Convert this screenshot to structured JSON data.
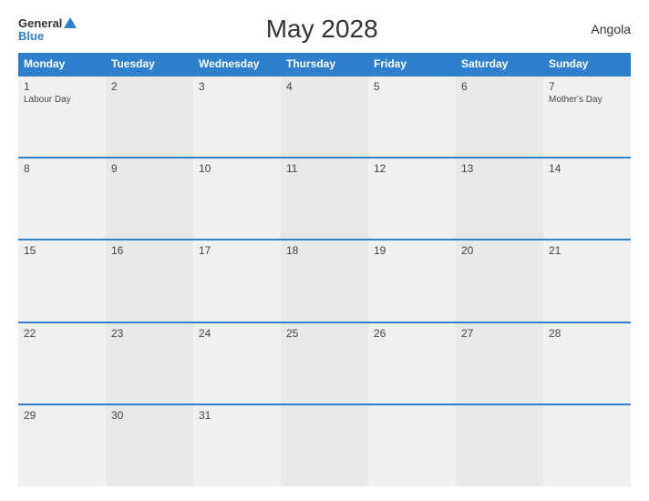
{
  "header": {
    "logo_general": "General",
    "logo_blue": "Blue",
    "title": "May 2028",
    "country": "Angola"
  },
  "weekdays": [
    "Monday",
    "Tuesday",
    "Wednesday",
    "Thursday",
    "Friday",
    "Saturday",
    "Sunday"
  ],
  "weeks": [
    [
      {
        "day": "1",
        "holiday": "Labour Day"
      },
      {
        "day": "2",
        "holiday": ""
      },
      {
        "day": "3",
        "holiday": ""
      },
      {
        "day": "4",
        "holiday": ""
      },
      {
        "day": "5",
        "holiday": ""
      },
      {
        "day": "6",
        "holiday": ""
      },
      {
        "day": "7",
        "holiday": "Mother's Day"
      }
    ],
    [
      {
        "day": "8",
        "holiday": ""
      },
      {
        "day": "9",
        "holiday": ""
      },
      {
        "day": "10",
        "holiday": ""
      },
      {
        "day": "11",
        "holiday": ""
      },
      {
        "day": "12",
        "holiday": ""
      },
      {
        "day": "13",
        "holiday": ""
      },
      {
        "day": "14",
        "holiday": ""
      }
    ],
    [
      {
        "day": "15",
        "holiday": ""
      },
      {
        "day": "16",
        "holiday": ""
      },
      {
        "day": "17",
        "holiday": ""
      },
      {
        "day": "18",
        "holiday": ""
      },
      {
        "day": "19",
        "holiday": ""
      },
      {
        "day": "20",
        "holiday": ""
      },
      {
        "day": "21",
        "holiday": ""
      }
    ],
    [
      {
        "day": "22",
        "holiday": ""
      },
      {
        "day": "23",
        "holiday": ""
      },
      {
        "day": "24",
        "holiday": ""
      },
      {
        "day": "25",
        "holiday": ""
      },
      {
        "day": "26",
        "holiday": ""
      },
      {
        "day": "27",
        "holiday": ""
      },
      {
        "day": "28",
        "holiday": ""
      }
    ],
    [
      {
        "day": "29",
        "holiday": ""
      },
      {
        "day": "30",
        "holiday": ""
      },
      {
        "day": "31",
        "holiday": ""
      },
      {
        "day": "",
        "holiday": ""
      },
      {
        "day": "",
        "holiday": ""
      },
      {
        "day": "",
        "holiday": ""
      },
      {
        "day": "",
        "holiday": ""
      }
    ]
  ]
}
